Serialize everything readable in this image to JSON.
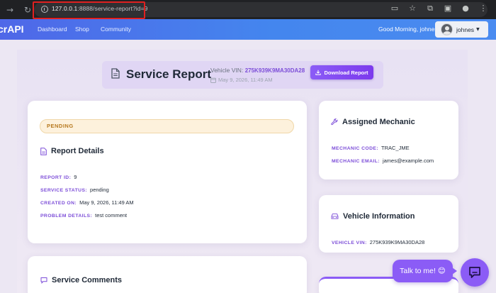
{
  "browser": {
    "url_host": "127.0.0.1",
    "url_rest": ":8888/service-report?id=9"
  },
  "navbar": {
    "brand": "crAPI",
    "links": [
      "Dashboard",
      "Shop",
      "Community"
    ],
    "greeting": "Good Morning, johnes!",
    "username": "johnes"
  },
  "header": {
    "title": "Service Report",
    "vin_label": "Vehicle VIN:",
    "vin_value": "275K939K9MA30DA28",
    "date": "May 9, 2026, 11:49 AM",
    "download_label": "Download Report"
  },
  "status": "PENDING",
  "report_details": {
    "title": "Report Details",
    "fields": [
      {
        "label": "REPORT ID:",
        "value": "9"
      },
      {
        "label": "SERVICE STATUS:",
        "value": "pending"
      },
      {
        "label": "CREATED ON:",
        "value": "May 9, 2026, 11:49 AM"
      },
      {
        "label": "PROBLEM DETAILS:",
        "value": "test comment"
      }
    ]
  },
  "comments": {
    "title": "Service Comments"
  },
  "mechanic": {
    "title": "Assigned Mechanic",
    "fields": [
      {
        "label": "MECHANIC CODE:",
        "value": "TRAC_JME"
      },
      {
        "label": "MECHANIC EMAIL:",
        "value": "james@example.com"
      }
    ]
  },
  "vehicle": {
    "title": "Vehicle Information",
    "fields": [
      {
        "label": "VEHICLE VIN:",
        "value": "275K939K9MA30DA28"
      }
    ]
  },
  "chat": {
    "bubble": "Talk to me! 😊"
  },
  "colors": {
    "accent": "#8b5cf6",
    "navbar": "#4486ee",
    "pending": "#b7791f"
  }
}
